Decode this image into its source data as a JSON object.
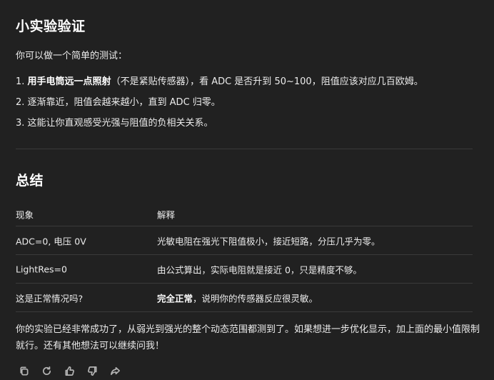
{
  "section1": {
    "title": "小实验验证",
    "intro": "你可以做一个简单的测试：",
    "item1_num": "1.",
    "item1_bold": "用手电筒远一点照射",
    "item1_rest": "（不是紧贴传感器），看 ADC 是否升到 50~100，阻值应该对应几百欧姆。",
    "item2": "2. 逐渐靠近，阻值会越来越小，直到 ADC 归零。",
    "item3": "3. 这能让你直观感受光强与阻值的负相关关系。"
  },
  "section2": {
    "title": "总结",
    "headers": [
      "现象",
      "解释"
    ],
    "rows": [
      {
        "phenomenon": "ADC=0, 电压 0V",
        "explanation": "光敏电阻在强光下阻值极小，接近短路，分压几乎为零。"
      },
      {
        "phenomenon": "LightRes=0",
        "explanation": "由公式算出，实际电阻就是接近 0，只是精度不够。"
      },
      {
        "phenomenon": "这是正常情况吗?",
        "explanation_bold": "完全正常",
        "explanation_rest": "，说明你的传感器反应很灵敏。"
      }
    ],
    "summary": "你的实验已经非常成功了，从弱光到强光的整个动态范围都测到了。如果想进一步优化显示，加上面的最小值限制就行。还有其他想法可以继续问我！"
  },
  "actions": [
    "copy-icon",
    "regenerate-icon",
    "thumbs-up-icon",
    "thumbs-down-icon",
    "share-icon"
  ]
}
